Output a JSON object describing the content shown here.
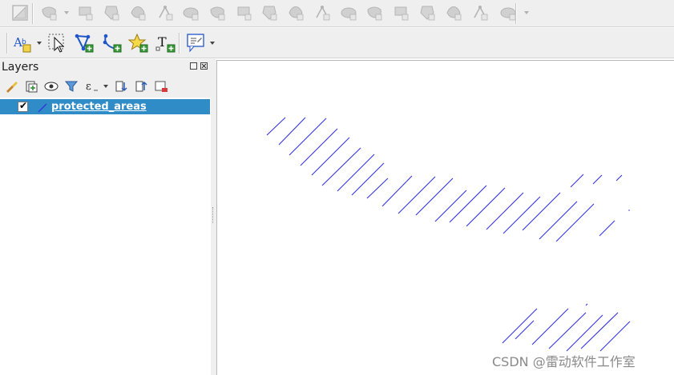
{
  "toolbar_digitizing": {
    "icons": [
      "toggle-editing-icon",
      "add-feature-icon",
      "move-feature-icon",
      "delete-feature-icon",
      "rotate-feature-icon",
      "add-ring-icon",
      "add-part-icon",
      "fill-ring-icon",
      "delete-ring-icon",
      "delete-part-icon",
      "reshape-features-icon",
      "offset-curve-icon",
      "vertex-tool-icon",
      "split-parts-icon",
      "split-features-icon",
      "merge-features-icon",
      "merge-attributes-icon",
      "simplify-feature-icon",
      "redo-icon"
    ]
  },
  "toolbar_labels": {
    "icons": [
      "label-tool-icon",
      "select-features-icon",
      "add-polygon-icon",
      "add-line-icon",
      "add-point-star-icon",
      "add-text-annotation-icon",
      "annotation-options-icon"
    ],
    "text_icon_glyph": "T"
  },
  "layers_panel": {
    "title": "Layers",
    "toolbar_icons": [
      "style-brush-icon",
      "add-group-icon",
      "visibility-eye-icon",
      "filter-legend-icon",
      "filter-expression-icon",
      "expand-all-icon",
      "collapse-all-icon",
      "remove-layer-icon"
    ],
    "layers": [
      {
        "name": "protected_areas",
        "checked": true,
        "selected": true,
        "checkmark": "✔"
      }
    ]
  },
  "map": {
    "hatch_color": "#3434e0",
    "background": "#ffffff"
  },
  "watermark": "CSDN @雷动软件工作室",
  "colors": {
    "toolbar_bg": "#efefef",
    "selection": "#308cc6",
    "icon_green": "#3a9a3a",
    "icon_blue": "#1f55c8",
    "disabled_gray": "#b4b4b4"
  }
}
